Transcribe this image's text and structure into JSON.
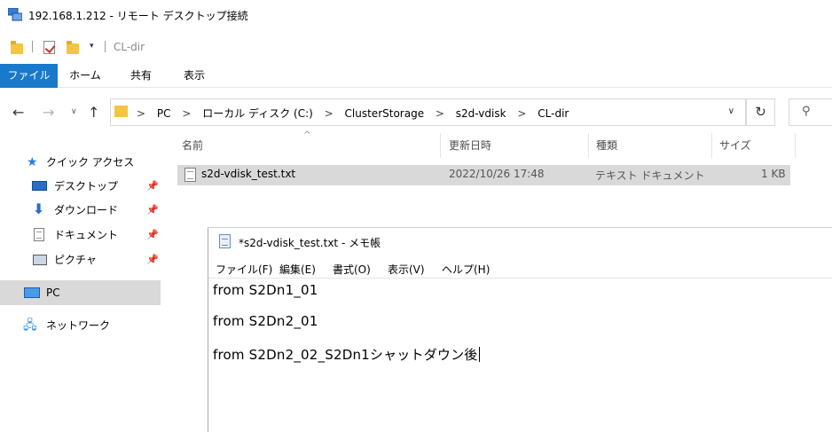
{
  "window": {
    "title": "192.168.1.212 - リモート デスクトップ接続"
  },
  "quick_access_toolbar": {
    "path_title": "CL-dir",
    "dropdown_glyph": "▾"
  },
  "ribbon": {
    "tabs": [
      "ファイル",
      "ホーム",
      "共有",
      "表示"
    ],
    "active_tab_color": "#1979ca"
  },
  "address_bar": {
    "crumbs": [
      "PC",
      "ローカル ディスク (C:)",
      "ClusterStorage",
      "s2d-vdisk",
      "CL-dir"
    ],
    "separator": ">"
  },
  "sidebar": {
    "items": [
      {
        "label": "クイック アクセス",
        "icon": "star-icon",
        "pinned": false
      },
      {
        "label": "デスクトップ",
        "icon": "desktop-icon",
        "pinned": true
      },
      {
        "label": "ダウンロード",
        "icon": "download-icon",
        "pinned": true
      },
      {
        "label": "ドキュメント",
        "icon": "documents-icon",
        "pinned": true
      },
      {
        "label": "ピクチャ",
        "icon": "pictures-icon",
        "pinned": true
      },
      {
        "label": "PC",
        "icon": "pc-icon",
        "pinned": false,
        "selected": true
      },
      {
        "label": "ネットワーク",
        "icon": "network-icon",
        "pinned": false
      }
    ]
  },
  "file_list": {
    "columns": [
      "名前",
      "更新日時",
      "種類",
      "サイズ"
    ],
    "rows": [
      {
        "name": "s2d-vdisk_test.txt",
        "modified": "2022/10/26 17:48",
        "type": "テキスト ドキュメント",
        "size": "1 KB",
        "icon": "text-file-icon"
      }
    ]
  },
  "notepad": {
    "title": "*s2d-vdisk_test.txt - メモ帳",
    "menu": [
      "ファイル(F)",
      "編集(E)",
      "書式(O)",
      "表示(V)",
      "ヘルプ(H)"
    ],
    "lines": [
      "from S2Dn1_01",
      "from S2Dn2_01",
      "from S2Dn2_02_S2Dn1シャットダウン後"
    ]
  }
}
